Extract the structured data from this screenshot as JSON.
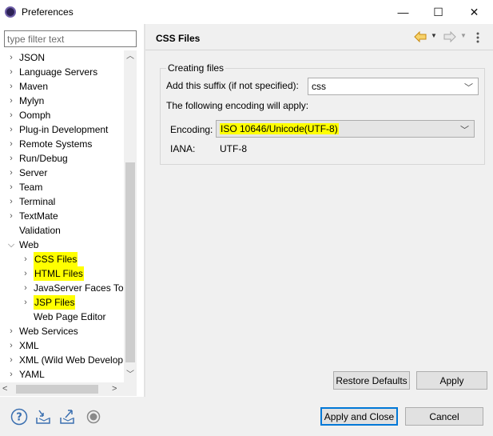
{
  "window": {
    "title": "Preferences",
    "minimize_glyph": "—",
    "maximize_glyph": "☐",
    "close_glyph": "✕"
  },
  "left": {
    "filter_placeholder": "type filter text",
    "tree": [
      {
        "label": "JSON",
        "level": 0,
        "expander": "collapsed",
        "highlight": false
      },
      {
        "label": "Language Servers",
        "level": 0,
        "expander": "collapsed",
        "highlight": false
      },
      {
        "label": "Maven",
        "level": 0,
        "expander": "collapsed",
        "highlight": false
      },
      {
        "label": "Mylyn",
        "level": 0,
        "expander": "collapsed",
        "highlight": false
      },
      {
        "label": "Oomph",
        "level": 0,
        "expander": "collapsed",
        "highlight": false
      },
      {
        "label": "Plug-in Development",
        "level": 0,
        "expander": "collapsed",
        "highlight": false
      },
      {
        "label": "Remote Systems",
        "level": 0,
        "expander": "collapsed",
        "highlight": false
      },
      {
        "label": "Run/Debug",
        "level": 0,
        "expander": "collapsed",
        "highlight": false
      },
      {
        "label": "Server",
        "level": 0,
        "expander": "collapsed",
        "highlight": false
      },
      {
        "label": "Team",
        "level": 0,
        "expander": "collapsed",
        "highlight": false
      },
      {
        "label": "Terminal",
        "level": 0,
        "expander": "collapsed",
        "highlight": false
      },
      {
        "label": "TextMate",
        "level": 0,
        "expander": "collapsed",
        "highlight": false
      },
      {
        "label": "Validation",
        "level": 0,
        "expander": "none",
        "highlight": false
      },
      {
        "label": "Web",
        "level": 0,
        "expander": "expanded",
        "highlight": false
      },
      {
        "label": "CSS Files",
        "level": 1,
        "expander": "collapsed",
        "highlight": true,
        "selected": true
      },
      {
        "label": "HTML Files",
        "level": 1,
        "expander": "collapsed",
        "highlight": true
      },
      {
        "label": "JavaServer Faces Too",
        "level": 1,
        "expander": "collapsed",
        "highlight": false
      },
      {
        "label": "JSP Files",
        "level": 1,
        "expander": "collapsed",
        "highlight": true
      },
      {
        "label": "Web Page Editor",
        "level": 1,
        "expander": "none",
        "highlight": false
      },
      {
        "label": "Web Services",
        "level": 0,
        "expander": "collapsed",
        "highlight": false
      },
      {
        "label": "XML",
        "level": 0,
        "expander": "collapsed",
        "highlight": false
      },
      {
        "label": "XML (Wild Web Develop",
        "level": 0,
        "expander": "collapsed",
        "highlight": false
      },
      {
        "label": "YAML",
        "level": 0,
        "expander": "collapsed",
        "highlight": false
      }
    ]
  },
  "right": {
    "title": "CSS Files",
    "group_title": "Creating files",
    "suffix_label": "Add this suffix (if not specified):",
    "suffix_value": "css",
    "encoding_note": "The following encoding will apply:",
    "encoding_label": "Encoding:",
    "encoding_value": "ISO 10646/Unicode(UTF-8)",
    "iana_label": "IANA:",
    "iana_value": "UTF-8",
    "restore_defaults": "Restore Defaults",
    "apply": "Apply"
  },
  "bottom": {
    "apply_and_close": "Apply and Close",
    "cancel": "Cancel"
  },
  "colors": {
    "highlight": "#ffff00",
    "primary_border": "#0078d7",
    "nav_arrow": "#e3a21a"
  }
}
